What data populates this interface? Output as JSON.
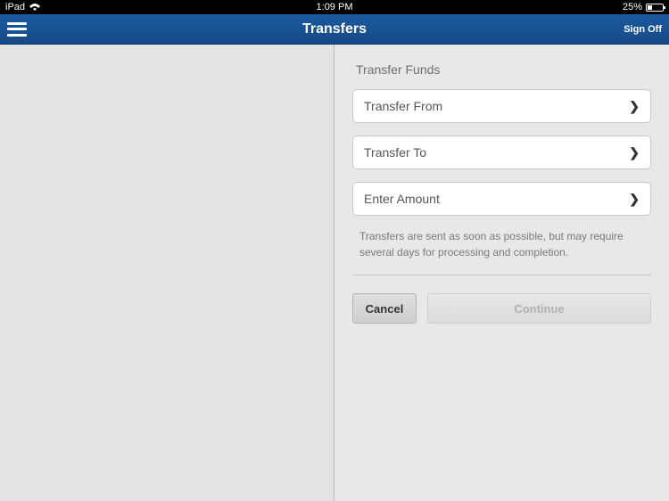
{
  "status": {
    "device": "iPad",
    "time": "1:09 PM",
    "battery_percent": "25%"
  },
  "nav": {
    "title": "Transfers",
    "sign_off_label": "Sign Off"
  },
  "form": {
    "section_title": "Transfer Funds",
    "rows": [
      {
        "label": "Transfer From"
      },
      {
        "label": "Transfer To"
      },
      {
        "label": "Enter Amount"
      }
    ],
    "helper_text": "Transfers are sent as soon as possible, but may require several days for processing and completion."
  },
  "buttons": {
    "cancel": "Cancel",
    "continue": "Continue"
  }
}
